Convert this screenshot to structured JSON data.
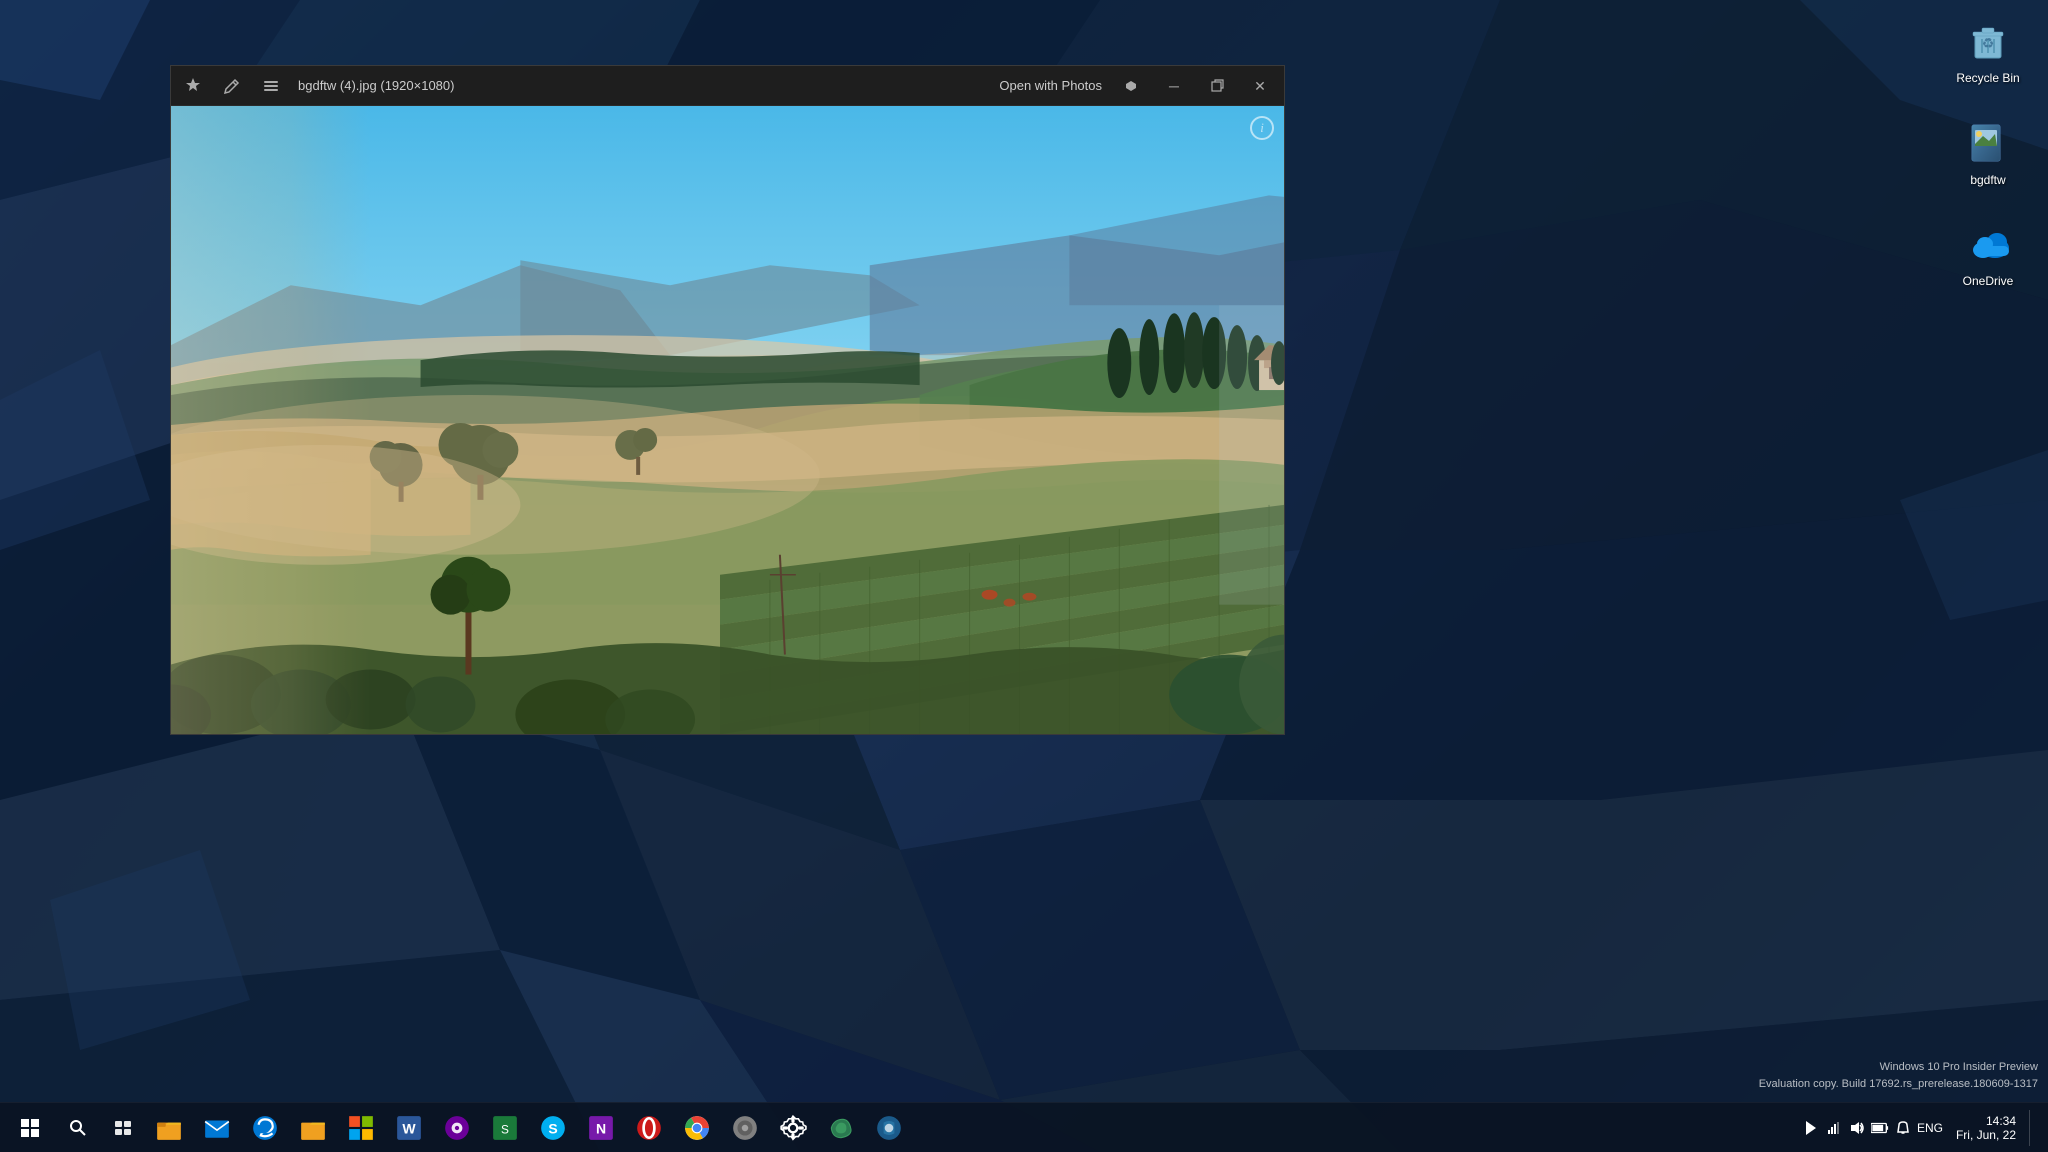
{
  "desktop": {
    "background_color": "#0d1f35",
    "icons": [
      {
        "id": "recycle-bin",
        "label": "Recycle Bin",
        "icon_type": "recycle-bin-icon"
      },
      {
        "id": "bgdftw",
        "label": "bgdftw",
        "icon_type": "image-icon"
      },
      {
        "id": "onedrive",
        "label": "OneDrive",
        "icon_type": "onedrive-icon"
      }
    ]
  },
  "photo_viewer": {
    "filename": "bgdftw (4).jpg (1920×1080)",
    "open_with_label": "Open with Photos",
    "toolbar_icons": [
      {
        "id": "pin",
        "symbol": "↑"
      },
      {
        "id": "pencil",
        "symbol": "✎"
      },
      {
        "id": "list",
        "symbol": "☰"
      }
    ],
    "window_controls": [
      {
        "id": "minimize",
        "symbol": "─"
      },
      {
        "id": "restore",
        "symbol": "⧉"
      },
      {
        "id": "close",
        "symbol": "✕"
      }
    ],
    "info_button": "i"
  },
  "taskbar": {
    "start_button": "⊞",
    "apps": [
      {
        "id": "start",
        "label": "Start"
      },
      {
        "id": "search",
        "label": "Search"
      },
      {
        "id": "task-view",
        "label": "Task View"
      },
      {
        "id": "file-explorer",
        "label": "File Explorer"
      },
      {
        "id": "mail",
        "label": "Mail"
      },
      {
        "id": "edge",
        "label": "Microsoft Edge"
      },
      {
        "id": "file-explorer2",
        "label": "File Explorer"
      },
      {
        "id": "store",
        "label": "Microsoft Store"
      },
      {
        "id": "word",
        "label": "Microsoft Word"
      },
      {
        "id": "groove",
        "label": "Groove Music"
      },
      {
        "id": "skype2",
        "label": "App"
      },
      {
        "id": "skype",
        "label": "Skype"
      },
      {
        "id": "onenote",
        "label": "OneNote"
      },
      {
        "id": "opera",
        "label": "Opera"
      },
      {
        "id": "chrome",
        "label": "Google Chrome"
      },
      {
        "id": "app1",
        "label": "App"
      },
      {
        "id": "settings",
        "label": "Settings"
      },
      {
        "id": "app2",
        "label": "App"
      },
      {
        "id": "app3",
        "label": "App"
      },
      {
        "id": "app4",
        "label": "App"
      }
    ],
    "system_tray": {
      "show_hidden": "^",
      "icons": [
        "network",
        "volume",
        "battery",
        "notifications"
      ],
      "language": "ENG",
      "time": "14:34",
      "date": "Fri, Jun, 22"
    }
  },
  "build_info": {
    "line1": "Windows 10 Pro Insider Preview",
    "line2": "Evaluation copy. Build 17692.rs_prerelease.180609-1317"
  }
}
